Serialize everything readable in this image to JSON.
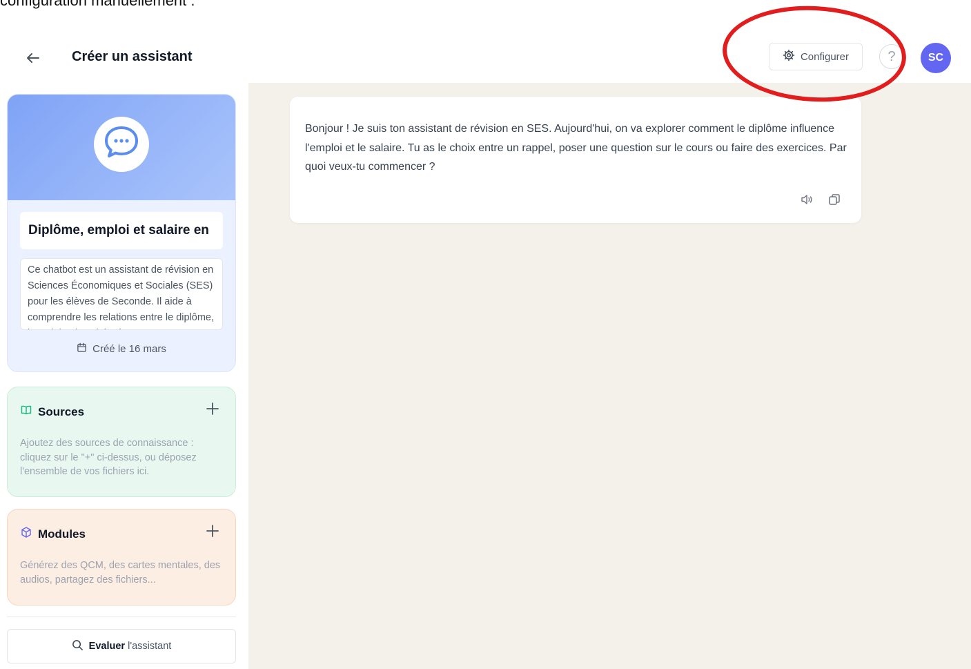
{
  "caption_top": "configuration manuellement :",
  "header": {
    "title": "Créer un assistant",
    "configure_label": "Configurer",
    "help_label": "?",
    "avatar_initials": "SC"
  },
  "assistant_card": {
    "name": "Diplôme, emploi et salaire en",
    "description": "Ce chatbot est un assistant de révision en Sciences Économiques et Sociales (SES) pour les élèves de Seconde. Il aide à comprendre les relations entre le diplôme, l'emploi et le salaire à travers",
    "created": "Créé le 16 mars"
  },
  "sources": {
    "title": "Sources",
    "description": "Ajoutez des sources de connaissance : cliquez sur le \"+\" ci-dessus, ou déposez l'ensemble de vos fichiers ici."
  },
  "modules": {
    "title": "Modules",
    "description": "Générez des QCM, des cartes mentales, des audios, partagez des fichiers..."
  },
  "evaluate": {
    "bold": "Evaluer",
    "rest": " l'assistant"
  },
  "chat": {
    "message": "Bonjour ! Je suis ton assistant de révision en SES. Aujourd'hui, on va explorer comment le diplôme influence l'emploi et le salaire. Tu as le choix entre un rappel, poser une question sur le cours ou faire des exercices. Par quoi veux-tu commencer ?"
  },
  "colors": {
    "annotation": "#e11d1d",
    "avatar": "#6366f1",
    "sources_accent": "#10b981",
    "modules_accent": "#6366f1"
  }
}
